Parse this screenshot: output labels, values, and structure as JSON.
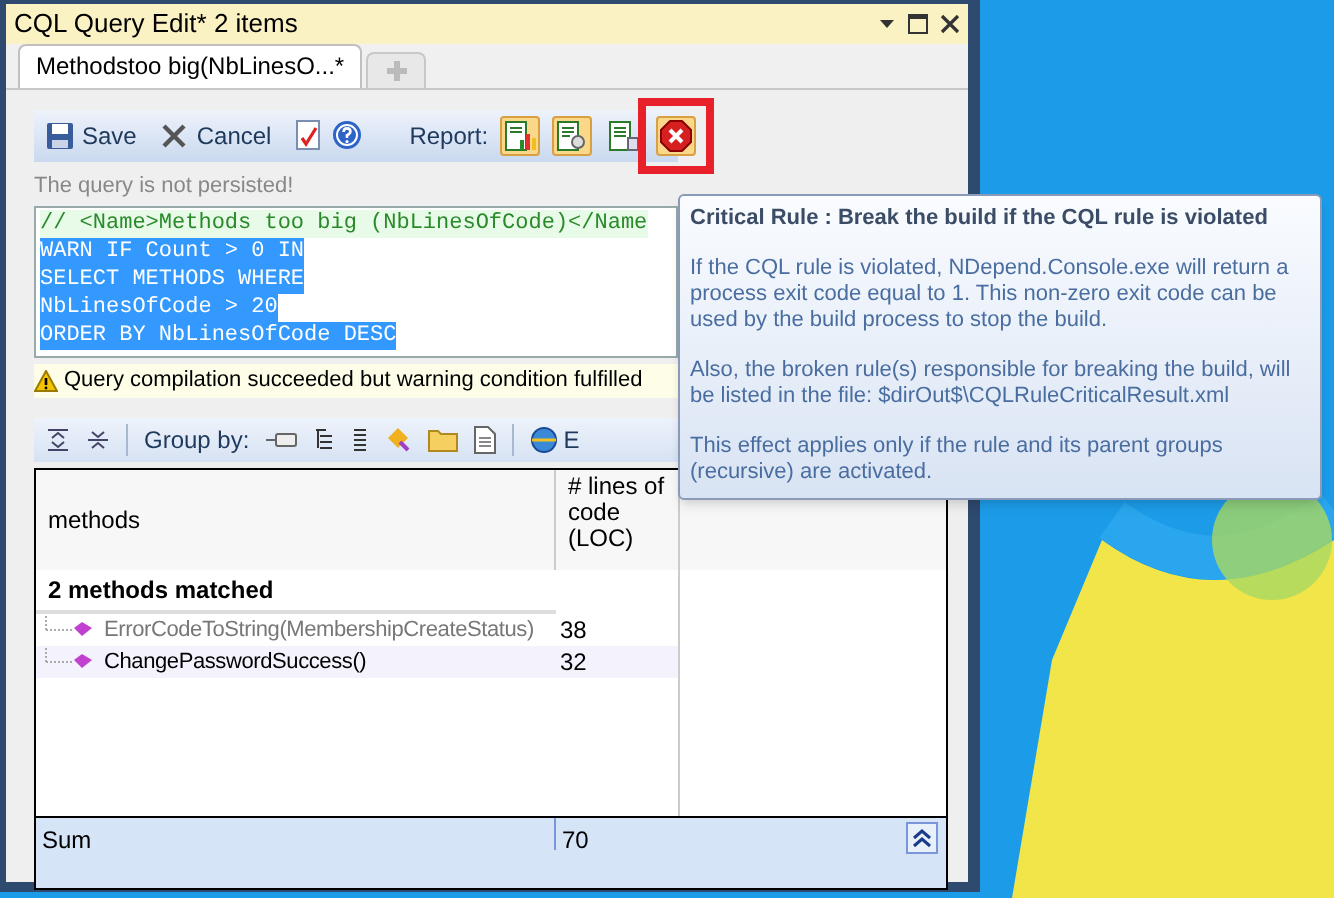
{
  "window": {
    "title": "CQL Query Edit*  2 items"
  },
  "tabs": [
    {
      "label": "Methodstoo big(NbLinesO...*",
      "selected": true
    }
  ],
  "toolbar": {
    "buttons": [
      {
        "kind": "save",
        "label": "Save"
      },
      {
        "kind": "cancel",
        "label": "Cancel"
      },
      {
        "kind": "check"
      },
      {
        "kind": "help"
      }
    ],
    "report_label": "Report:",
    "report_buttons": [
      {
        "kind": "chart",
        "highlighted": false,
        "on": true
      },
      {
        "kind": "search",
        "highlighted": false,
        "on": true
      },
      {
        "kind": "list",
        "highlighted": false,
        "on": false
      },
      {
        "kind": "critical",
        "highlighted": true,
        "on": true
      }
    ]
  },
  "status_message": "The query is not persisted!",
  "editor": {
    "lines": [
      {
        "text": "// <Name>Methods too big (NbLinesOfCode)</Name",
        "kind": "comment",
        "selected": false
      },
      {
        "text": "WARN IF Count > 0 IN",
        "kind": "code",
        "selected": true
      },
      {
        "text": "SELECT METHODS WHERE",
        "kind": "code",
        "selected": true
      },
      {
        "text": "NbLinesOfCode > 20",
        "kind": "code",
        "selected": true
      },
      {
        "text": "ORDER BY NbLinesOfCode DESC",
        "kind": "code",
        "selected": true
      }
    ]
  },
  "warning": "Query compilation succeeded but warning condition fulfilled",
  "results_toolbar": {
    "group_by_label": "Group by:",
    "export_label": "E"
  },
  "table": {
    "columns": [
      "methods",
      "# lines of code (LOC)"
    ],
    "group_header": "2 methods matched",
    "rows": [
      {
        "name": "ErrorCodeToString(MembershipCreateStatus)",
        "loc": "38",
        "greyed": true,
        "selected": false
      },
      {
        "name": "ChangePasswordSuccess()",
        "loc": "32",
        "greyed": false,
        "selected": true
      }
    ],
    "footer": {
      "label": "Sum",
      "loc": "70"
    }
  },
  "tooltip": {
    "title": "Critical Rule : Break the build if the CQL rule is violated",
    "paragraphs": [
      "If the CQL rule is violated, NDepend.Console.exe will return a process exit code equal to 1. This non-zero exit code can be used by the build process to stop the build.",
      "Also, the broken rule(s) responsible for breaking the build, will be listed in the file: $dirOut$\\CQLRuleCriticalResult.xml",
      "This effect applies only if the rule and its parent groups (recursive) are activated."
    ]
  }
}
